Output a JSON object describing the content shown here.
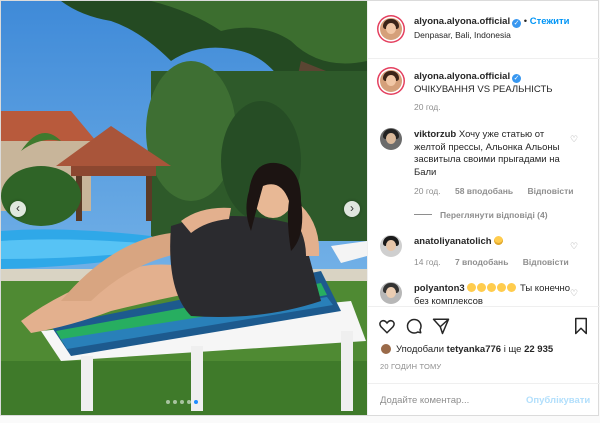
{
  "post": {
    "username": "alyona.alyona.official",
    "follow_sep": "•",
    "follow_label": "Стежити",
    "location": "Denpasar, Bali, Indonesia",
    "caption": "ОЧІКУВАННЯ VS РЕАЛЬНІСТЬ",
    "caption_time": "20 год.",
    "carousel": {
      "count": 5,
      "active": 4
    }
  },
  "comments": [
    {
      "username": "viktorzub",
      "text": "Хочу уже статью от желтой прессы, Альонка Альоны засвитыла своими прыгадами на Бали",
      "time": "20 год.",
      "likes": "58 вподобань",
      "reply": "Відповісти",
      "view_replies": "Переглянути відповіді (4)"
    },
    {
      "username": "anatoliyanatolich",
      "text": "",
      "time": "14 год.",
      "likes": "7 вподобань",
      "reply": "Відповісти"
    },
    {
      "username": "polyanton3",
      "text": "Ты конечно без комплексов"
    }
  ],
  "likes": {
    "prefix": "Уподобали",
    "user": "tetyanka776",
    "suffix": "і ще",
    "count": "22 935"
  },
  "timestamp": "20 ГОДИН ТОМУ",
  "add_comment": {
    "placeholder": "Додайте коментар...",
    "publish_label": "Опублікувати"
  },
  "icons": [
    "chevron-left-icon",
    "chevron-right-icon",
    "heart-icon",
    "comment-icon",
    "share-icon",
    "bookmark-icon",
    "verified-icon"
  ],
  "colors": {
    "link": "#0095f6",
    "verified": "#3897f0",
    "muted": "#8e8e8e",
    "publish_disabled": "#b2dffc"
  }
}
